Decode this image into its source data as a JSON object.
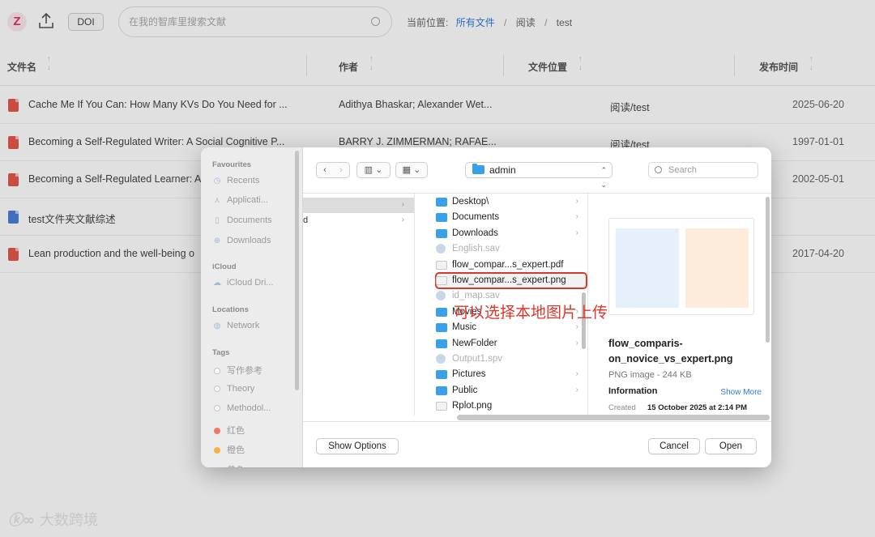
{
  "app": {
    "logo_letter": "Z",
    "doi_label": "DOI",
    "search_placeholder": "在我的智库里搜索文献",
    "breadcrumb": {
      "prefix": "当前位置:",
      "root": "所有文件",
      "mid": "阅读",
      "leaf": "test"
    }
  },
  "table": {
    "headers": [
      "文件名",
      "作者",
      "文件位置",
      "发布时间"
    ],
    "rows": [
      {
        "type": "pdf",
        "title": "Cache Me If You Can: How Many KVs Do You Need for ...",
        "author": "Adithya Bhaskar; Alexander Wet...",
        "loc": "阅读/test",
        "date": "2025-06-20"
      },
      {
        "type": "pdf",
        "title": "Becoming a Self-Regulated Writer: A Social Cognitive P...",
        "author": "BARRY J. ZIMMERMAN; RAFAE...",
        "loc": "阅读/test",
        "date": "1997-01-01"
      },
      {
        "type": "pdf",
        "title": "Becoming a Self-Regulated Learner: A",
        "author": "",
        "loc": "",
        "date": "2002-05-01"
      },
      {
        "type": "doc",
        "title": "test文件夹文献综述",
        "author": "",
        "loc": "",
        "date": ""
      },
      {
        "type": "pdf",
        "title": "Lean production and the well-being o",
        "author": "",
        "loc": "",
        "date": "2017-04-20"
      }
    ]
  },
  "dialog": {
    "sidebar": {
      "favourites_label": "Favourites",
      "favourites": [
        "Recents",
        "Applicati...",
        "Documents",
        "Downloads"
      ],
      "icloud_label": "iCloud",
      "icloud": [
        "iCloud Dri..."
      ],
      "locations_label": "Locations",
      "locations": [
        "Network"
      ],
      "tags_label": "Tags",
      "tags": [
        {
          "name": "写作参考",
          "color": "#ffffff"
        },
        {
          "name": "Theory",
          "color": "#ffffff"
        },
        {
          "name": "Methodol...",
          "color": "#ffffff"
        },
        {
          "name": "红色",
          "color": "#f07a6a"
        },
        {
          "name": "橙色",
          "color": "#f5b04a"
        },
        {
          "name": "黄色",
          "color": "#f0d04a"
        }
      ]
    },
    "location": "admin",
    "search_placeholder": "Search",
    "col1_items": [
      {
        "text": "",
        "selected": true
      },
      {
        "text": "d",
        "selected": false
      }
    ],
    "files": [
      {
        "name": "Desktop\\",
        "kind": "folder",
        "chev": true,
        "dim": false
      },
      {
        "name": "Documents",
        "kind": "folder",
        "chev": true,
        "dim": false
      },
      {
        "name": "Downloads",
        "kind": "folder",
        "chev": true,
        "dim": false
      },
      {
        "name": "English.sav",
        "kind": "gray",
        "chev": false,
        "dim": true
      },
      {
        "name": "flow_compar...s_expert.pdf",
        "kind": "file",
        "chev": false,
        "dim": false
      },
      {
        "name": "flow_compar...s_expert.png",
        "kind": "file",
        "chev": false,
        "dim": false,
        "highlight": true
      },
      {
        "name": "id_map.sav",
        "kind": "gray",
        "chev": false,
        "dim": true
      },
      {
        "name": "Movies",
        "kind": "folder",
        "chev": true,
        "dim": false
      },
      {
        "name": "Music",
        "kind": "folder",
        "chev": true,
        "dim": false
      },
      {
        "name": "NewFolder",
        "kind": "folder",
        "chev": true,
        "dim": false
      },
      {
        "name": "Output1.spv",
        "kind": "gray",
        "chev": false,
        "dim": true
      },
      {
        "name": "Pictures",
        "kind": "folder",
        "chev": true,
        "dim": false
      },
      {
        "name": "Public",
        "kind": "folder",
        "chev": true,
        "dim": false
      },
      {
        "name": "Rplot.png",
        "kind": "file",
        "chev": false,
        "dim": false
      }
    ],
    "annotation": "可以选择本地图片上传",
    "preview": {
      "name": "flow_comparis-on_novice_vs_expert.png",
      "type": "PNG image - 244 KB",
      "info_label": "Information",
      "show_more": "Show More",
      "created_label": "Created",
      "created_value": "15 October 2025 at 2:14 PM"
    },
    "buttons": {
      "show_options": "Show Options",
      "cancel": "Cancel",
      "open": "Open"
    }
  },
  "watermark": "大数跨境"
}
